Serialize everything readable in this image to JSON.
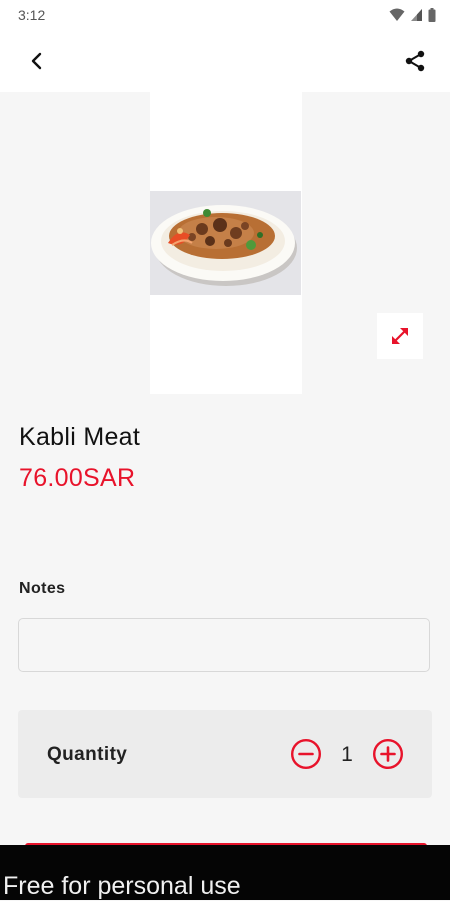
{
  "status_bar": {
    "time": "3:12",
    "icons": [
      "wifi-icon",
      "signal-icon",
      "battery-icon"
    ]
  },
  "app_bar": {
    "back_icon": "chevron-left-icon",
    "share_icon": "share-icon"
  },
  "product": {
    "image_icon": "food-photo",
    "expand_icon": "expand-icon",
    "name": "Kabli Meat",
    "price": "76.00SAR"
  },
  "notes": {
    "label": "Notes",
    "value": "",
    "placeholder": ""
  },
  "quantity": {
    "label": "Quantity",
    "value": "1",
    "minus_icon": "minus-circle-icon",
    "plus_icon": "plus-circle-icon"
  },
  "watermark": {
    "text": "Free for personal use"
  },
  "colors": {
    "accent": "#e8132b",
    "background": "#f6f6f6",
    "quantity_background": "#ececec",
    "watermark_bar": "#050505"
  }
}
